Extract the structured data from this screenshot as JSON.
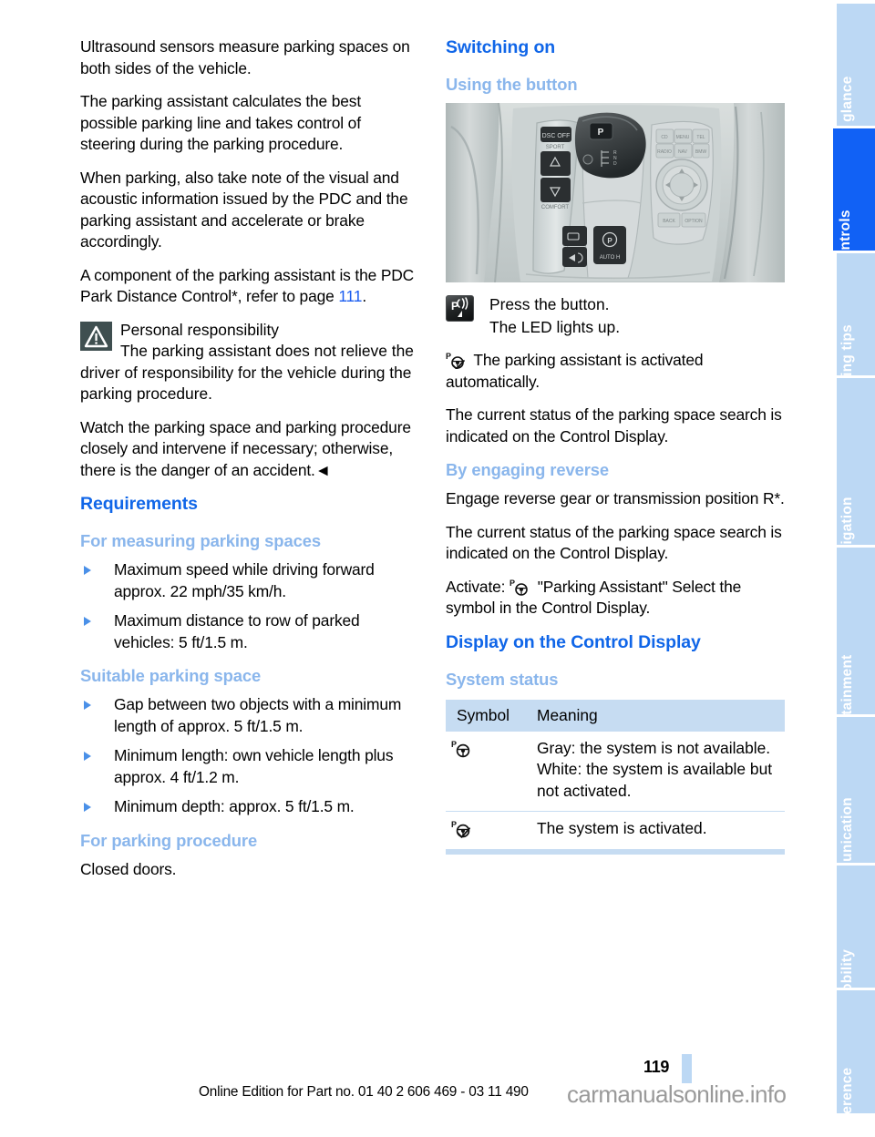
{
  "document": {
    "page_number": "119",
    "footer_note": "Online Edition for Part no. 01 40 2 606 469 - 03 11 490",
    "watermark": "carmanualsonline.info"
  },
  "colors": {
    "heading_primary": "#1066e8",
    "heading_secondary": "#8ab6ec",
    "link": "#1a5cf0",
    "tab_inactive": "#bcd8f4",
    "tab_active": "#1161f5",
    "table_band": "#c6dcf2",
    "bullet": "#4a90e8",
    "warning_box": "#3f4f50"
  },
  "left_column": {
    "paragraphs": [
      "Ultrasound sensors measure parking spaces on both sides of the vehicle.",
      "The parking assistant calculates the best possible parking line and takes control of steering during the parking procedure.",
      "When parking, also take note of the visual and acoustic information issued by the PDC and the parking assistant and accelerate or brake accordingly."
    ],
    "pdc_paragraph": {
      "before": "A component of the parking assistant is the PDC Park Distance Control*, refer to page ",
      "page_link": "111",
      "after": "."
    },
    "warning": {
      "icon": "warning-triangle-icon",
      "title": "Personal responsibility",
      "body": "The parking assistant does not relieve the driver of responsibility for the vehicle during the parking procedure.",
      "closing": "Watch the parking space and parking procedure closely and intervene if necessary; otherwise, there is the danger of an accident.",
      "end_mark": "◄"
    },
    "requirements": {
      "heading": "Requirements",
      "sections": [
        {
          "heading": "For measuring parking spaces",
          "bullets": [
            "Maximum speed while driving forward approx. 22 mph/35 km/h.",
            "Maximum distance to row of parked vehicles: 5 ft/1.5 m."
          ]
        },
        {
          "heading": "Suitable parking space",
          "bullets": [
            "Gap between two objects with a minimum length of approx. 5 ft/1.5 m.",
            "Minimum length: own vehicle length plus approx. 4 ft/1.2 m.",
            "Minimum depth: approx. 5 ft/1.5 m."
          ]
        },
        {
          "heading": "For parking procedure",
          "text": "Closed doors."
        }
      ]
    }
  },
  "right_column": {
    "switching_on": {
      "heading": "Switching on",
      "using_button": {
        "heading": "Using the button",
        "image_caption": "center-console-gear-selector-idrive-photo",
        "step_icon": "parking-assistant-button-icon",
        "step_line1": "Press the button.",
        "step_line2": "The LED lights up.",
        "auto_symbol": "p-steering-wheel-activated-icon",
        "auto_text": "The parking assistant is activated automatically.",
        "status_text": "The current status of the parking space search is indicated on the Control Display."
      },
      "by_reverse": {
        "heading": "By engaging reverse",
        "paragraph1": "Engage reverse gear or transmission position R*.",
        "paragraph2": "The current status of the parking space search is indicated on the Control Display.",
        "activate_prefix": "Activate: ",
        "activate_symbol": "p-steering-wheel-icon",
        "activate_suffix": " \"Parking Assistant\" Select the symbol in the Control Display."
      }
    },
    "control_display": {
      "heading": "Display on the Control Display",
      "subheading": "System status",
      "table": {
        "columns": [
          "Symbol",
          "Meaning"
        ],
        "rows": [
          {
            "symbol": "p-steering-wheel-icon",
            "lines": [
              "Gray: the system is not available.",
              "White: the system is available but not activated."
            ]
          },
          {
            "symbol": "p-steering-wheel-activated-icon",
            "lines": [
              "The system is activated."
            ]
          }
        ]
      }
    }
  },
  "sidebar": {
    "tabs": [
      {
        "label": "At a glance",
        "active": false
      },
      {
        "label": "Controls",
        "active": true
      },
      {
        "label": "Driving tips",
        "active": false
      },
      {
        "label": "Navigation",
        "active": false
      },
      {
        "label": "Entertainment",
        "active": false
      },
      {
        "label": "Communication",
        "active": false
      },
      {
        "label": "Mobility",
        "active": false
      },
      {
        "label": "Reference",
        "active": false
      }
    ]
  }
}
